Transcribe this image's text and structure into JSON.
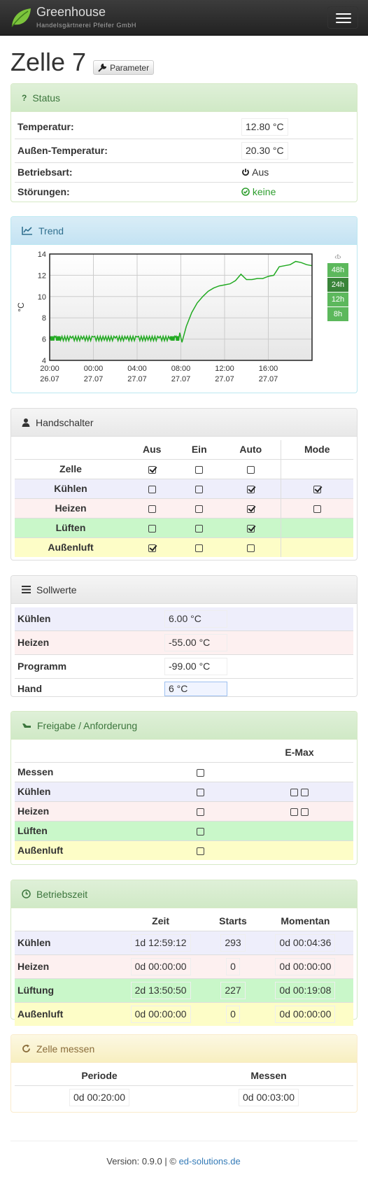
{
  "app": {
    "title": "Greenhouse",
    "subtitle": "Handelsgärtnerei Pfeifer GmbH"
  },
  "page": {
    "title": "Zelle 7",
    "param_button": "Parameter"
  },
  "status": {
    "heading": "Status",
    "rows": [
      {
        "label": "Temperatur:",
        "value": "12.80 °C"
      },
      {
        "label": "Außen-Temperatur:",
        "value": "20.30 °C"
      },
      {
        "label": "Betriebsart:",
        "value": "Aus"
      },
      {
        "label": "Störungen:",
        "value": "keine"
      }
    ]
  },
  "trend": {
    "heading": "Trend",
    "range_header": "‹t›",
    "ranges": [
      "48h",
      "24h",
      "12h",
      "8h"
    ],
    "active_range": "24h"
  },
  "chart_data": {
    "type": "line",
    "title": "",
    "xlabel": "",
    "ylabel": "°C",
    "ylim": [
      4,
      14
    ],
    "yticks": [
      "4",
      "6",
      "8",
      "10",
      "12",
      "14"
    ],
    "xtick_times": [
      "20:00",
      "00:00",
      "04:00",
      "08:00",
      "12:00",
      "16:00"
    ],
    "xtick_dates": [
      "26.07",
      "27.07",
      "27.07",
      "27.07",
      "27.07",
      "27.07"
    ],
    "grid": true,
    "color": "#22aa22",
    "series": [
      {
        "x": [
          0,
          0.5,
          1,
          2,
          3,
          4,
          5,
          6,
          7,
          8,
          9,
          10,
          11,
          11.5,
          11.9,
          12.1,
          12.5,
          13,
          13.5,
          14,
          14.5,
          15,
          15.5,
          16,
          16.5,
          17,
          17.5,
          18,
          18.5,
          19,
          19.5,
          20,
          20.5,
          21,
          21.5,
          22,
          22.5,
          23,
          23.5,
          24
        ],
        "y": [
          6.0,
          6.2,
          5.9,
          6.1,
          6.0,
          6.2,
          5.9,
          6.1,
          6.0,
          6.2,
          5.9,
          6.1,
          6.0,
          6.2,
          6.6,
          5.7,
          7.2,
          8.5,
          9.4,
          10.0,
          10.5,
          10.8,
          11.0,
          11.1,
          11.2,
          11.5,
          12.1,
          11.6,
          11.6,
          11.7,
          11.7,
          11.9,
          12.0,
          12.8,
          12.9,
          13.0,
          13.3,
          13.2,
          13.0,
          12.9
        ]
      }
    ]
  },
  "handschalter": {
    "heading": "Handschalter",
    "columns": [
      "Aus",
      "Ein",
      "Auto",
      "Mode"
    ],
    "rows": [
      {
        "label": "Zelle",
        "aus": true,
        "ein": false,
        "auto": false,
        "mode": null
      },
      {
        "label": "Kühlen",
        "aus": false,
        "ein": false,
        "auto": true,
        "mode": true
      },
      {
        "label": "Heizen",
        "aus": false,
        "ein": false,
        "auto": true,
        "mode": false
      },
      {
        "label": "Lüften",
        "aus": false,
        "ein": false,
        "auto": true,
        "mode": null
      },
      {
        "label": "Außenluft",
        "aus": true,
        "ein": false,
        "auto": false,
        "mode": null
      }
    ]
  },
  "sollwerte": {
    "heading": "Sollwerte",
    "rows": [
      {
        "label": "Kühlen",
        "value": "6.00 °C"
      },
      {
        "label": "Heizen",
        "value": "-55.00 °C"
      },
      {
        "label": "Programm",
        "value": "-99.00 °C"
      },
      {
        "label": "Hand",
        "value": "6 °C"
      }
    ]
  },
  "freigabe": {
    "heading": "Freigabe / Anforderung",
    "emax_label": "E-Max",
    "rows": [
      {
        "label": "Messen",
        "freigabe": false,
        "emax": []
      },
      {
        "label": "Kühlen",
        "freigabe": false,
        "emax": [
          false,
          false
        ]
      },
      {
        "label": "Heizen",
        "freigabe": false,
        "emax": [
          false,
          false
        ]
      },
      {
        "label": "Lüften",
        "freigabe": false,
        "emax": []
      },
      {
        "label": "Außenluft",
        "freigabe": false,
        "emax": []
      }
    ]
  },
  "betriebszeit": {
    "heading": "Betriebszeit",
    "columns": [
      "Zeit",
      "Starts",
      "Momentan"
    ],
    "rows": [
      {
        "label": "Kühlen",
        "zeit": "1d 12:59:12",
        "starts": "293",
        "momentan": "0d 00:04:36"
      },
      {
        "label": "Heizen",
        "zeit": "0d 00:00:00",
        "starts": "0",
        "momentan": "0d 00:00:00"
      },
      {
        "label": "Lüftung",
        "zeit": "2d 13:50:50",
        "starts": "227",
        "momentan": "0d 00:19:08"
      },
      {
        "label": "Außenluft",
        "zeit": "0d 00:00:00",
        "starts": "0",
        "momentan": "0d 00:00:00"
      }
    ]
  },
  "zelle_messen": {
    "heading": "Zelle messen",
    "columns": [
      "Periode",
      "Messen"
    ],
    "values": [
      "0d 00:20:00",
      "0d 00:03:00"
    ]
  },
  "footer": {
    "version_text": "Version: 0.9.0 | ©",
    "link_text": "ed-solutions.de"
  }
}
